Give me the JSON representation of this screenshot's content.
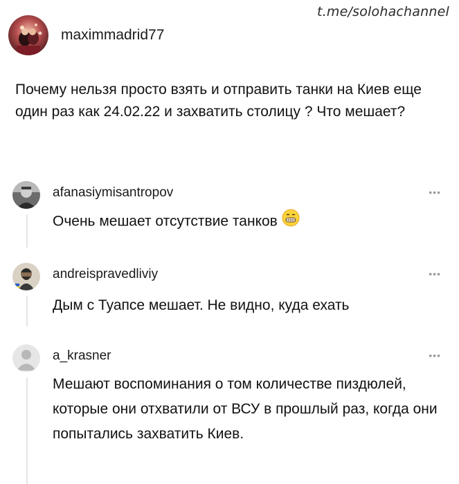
{
  "watermark": "t.me/solohachannel",
  "post": {
    "author": "maximmadrid77",
    "text": "Почему нельзя просто взять и отправить танки на Киев еще один раз как 24.02.22 и захватить столицу ? Что мешает?"
  },
  "comments": [
    {
      "username": "afanasiymisantropov",
      "text": "Очень мешает отсутствие танков",
      "emoji": "grinning-face-icon",
      "more": "•••"
    },
    {
      "username": "andreispravedliviy",
      "text": "Дым с Туапсе мешает. Не видно, куда ехать",
      "more": "•••"
    },
    {
      "username": "a_krasner",
      "text": "Мешают воспоминания о том количестве пиздюлей, которые они отхватили от ВСУ в прошлый раз, когда они попытались захватить Киев.",
      "more": "•••"
    }
  ],
  "colors": {
    "background": "#ffffff",
    "text": "#111111",
    "muted": "#9a9a9a",
    "thread_line": "#e4e4e4"
  }
}
